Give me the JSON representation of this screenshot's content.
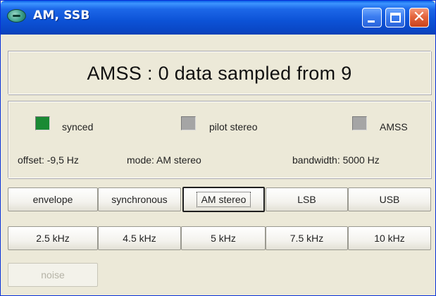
{
  "window": {
    "title": "AM, SSB",
    "controls": {
      "minimize": "minimize",
      "maximize": "maximize",
      "close": "close"
    },
    "colors": {
      "titlebar": "#0c52d6",
      "close": "#e4653d"
    }
  },
  "status": {
    "text": "AMSS : 0 data sampled from 9"
  },
  "indicators": [
    {
      "label": "synced",
      "color": "#1a8a34",
      "state": "on"
    },
    {
      "label": "pilot stereo",
      "color": "#a5a5a5",
      "state": "off"
    },
    {
      "label": "AMSS",
      "color": "#a5a5a5",
      "state": "off"
    }
  ],
  "info": {
    "offset": "offset: -9,5 Hz",
    "mode": "mode: AM stereo",
    "bandwidth": "bandwidth: 5000 Hz"
  },
  "demod_buttons": [
    {
      "label": "envelope",
      "selected": false
    },
    {
      "label": "synchronous",
      "selected": false
    },
    {
      "label": "AM stereo",
      "selected": true
    },
    {
      "label": "LSB",
      "selected": false
    },
    {
      "label": "USB",
      "selected": false
    }
  ],
  "bandwidth_buttons": [
    {
      "label": "2.5 kHz"
    },
    {
      "label": "4.5 kHz"
    },
    {
      "label": "5 kHz"
    },
    {
      "label": "7.5 kHz"
    },
    {
      "label": "10 kHz"
    }
  ],
  "noise_button": {
    "label": "noise",
    "enabled": false
  }
}
